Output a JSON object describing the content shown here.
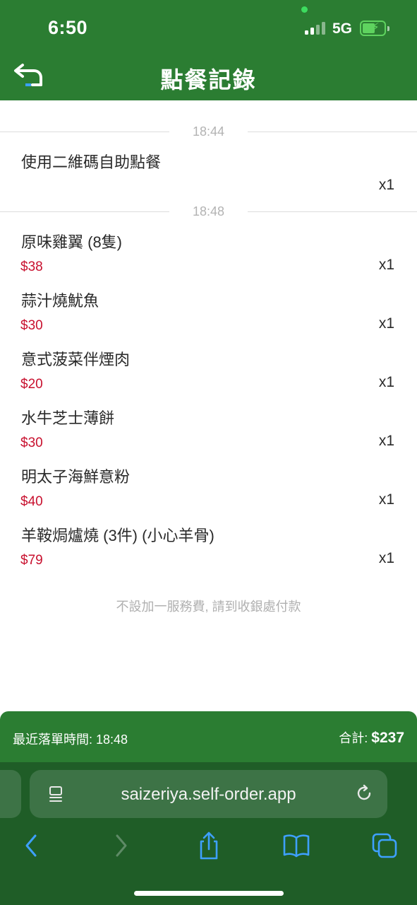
{
  "status_bar": {
    "time": "6:50",
    "network": "5G"
  },
  "header": {
    "title": "點餐記錄"
  },
  "groups": [
    {
      "time": "18:44",
      "items": [
        {
          "name": "使用二維碼自助點餐",
          "price": "",
          "qty": "x1"
        }
      ]
    },
    {
      "time": "18:48",
      "items": [
        {
          "name": "原味雞翼 (8隻)",
          "price": "$38",
          "qty": "x1"
        },
        {
          "name": "蒜汁燒魷魚",
          "price": "$30",
          "qty": "x1"
        },
        {
          "name": "意式菠菜伴煙肉",
          "price": "$20",
          "qty": "x1"
        },
        {
          "name": "水牛芝士薄餅",
          "price": "$30",
          "qty": "x1"
        },
        {
          "name": "明太子海鮮意粉",
          "price": "$40",
          "qty": "x1"
        },
        {
          "name": "羊鞍焗爐燒 (3件) (小心羊骨)",
          "price": "$79",
          "qty": "x1"
        }
      ]
    }
  ],
  "note": "不設加一服務費, 請到收銀處付款",
  "summary": {
    "last_order": "最近落單時間: 18:48",
    "total_label": "合計:",
    "total_value": "$237"
  },
  "browser": {
    "url": "saizeriya.self-order.app"
  },
  "icons": {
    "back": "back-arrow-icon",
    "page-menu": "page-menu-icon",
    "reload": "reload-icon",
    "nav-back": "chevron-left-icon",
    "nav-forward": "chevron-right-icon",
    "share": "share-icon",
    "bookmarks": "book-icon",
    "tabs": "tabs-icon"
  },
  "colors": {
    "brand_green": "#2b7d32",
    "price_red": "#c8102e",
    "browser_green": "#1f5d27"
  }
}
